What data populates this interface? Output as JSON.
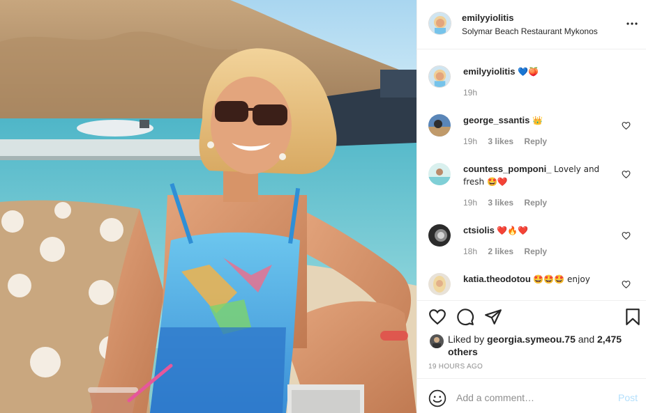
{
  "post": {
    "author": "emilyyiolitis",
    "location": "Solymar Beach Restaurant Mykonos"
  },
  "caption": {
    "username": "emilyyiolitis",
    "text": "💙🍑",
    "time": "19h"
  },
  "comments": [
    {
      "username": "george_ssantis",
      "text": "👑",
      "time": "19h",
      "likes": "3 likes",
      "reply": "Reply"
    },
    {
      "username": "countess_pomponi_",
      "text": "Lovely and fresh 🤩❤️",
      "time": "19h",
      "likes": "3 likes",
      "reply": "Reply"
    },
    {
      "username": "ctsiolis",
      "text": "❤️🔥❤️",
      "time": "18h",
      "likes": "2 likes",
      "reply": "Reply"
    },
    {
      "username": "katia.theodotou",
      "text": "🤩🤩🤩 enjoy",
      "time": "",
      "likes": "",
      "reply": ""
    }
  ],
  "likes": {
    "prefix": "Liked by",
    "user": "georgia.symeou.75",
    "and": "and",
    "others": "2,475 others"
  },
  "timestamp": "19 HOURS AGO",
  "add_comment": {
    "placeholder": "Add a comment…",
    "post_label": "Post"
  },
  "colors": {
    "accent": "#0095f6",
    "post_disabled": "#b2dffc",
    "muted": "#8e8e8e",
    "heart_red": "#ed4956"
  }
}
